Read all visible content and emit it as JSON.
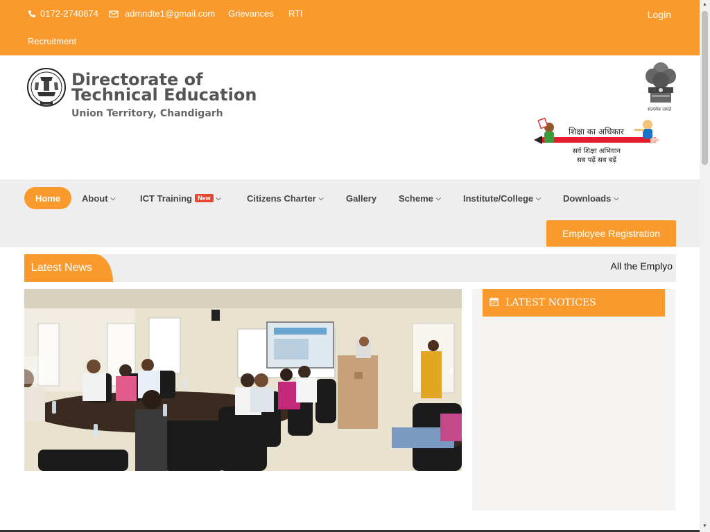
{
  "topbar": {
    "phone": "0172-2740674",
    "email": "admndte1@gmail.com",
    "grievances": "Grievances",
    "rti": "RTI",
    "recruitment": "Recruitment",
    "login": "Login",
    "phone_icon": "phone-icon",
    "email_icon": "envelope-icon"
  },
  "header": {
    "title": "Directorate of Technical Education",
    "subtitle": "Union Territory, Chandigarh",
    "emblem_caption": "सत्यमेव जयते",
    "ssa_title": "शिक्षा का अधिकार",
    "ssa_line1": "सर्व शिक्षा अभियान",
    "ssa_line2": "सब पढ़ें सब बढ़ें"
  },
  "nav": {
    "home": "Home",
    "about": "About",
    "ict": "ICT Training",
    "ict_badge": "New",
    "citizens": "Citizens Charter",
    "gallery": "Gallery",
    "scheme": "Scheme",
    "institute": "Institute/College",
    "downloads": "Downloads",
    "employee_registration": "Employee Registration"
  },
  "news": {
    "label": "Latest News",
    "ticker": "All the Emplyo"
  },
  "slider": {
    "prev": "‹",
    "next": "›"
  },
  "notices": {
    "title": "LATEST NOTICES",
    "icon": "calendar-icon"
  },
  "colors": {
    "accent": "#fb9a2c",
    "nav_bg": "#eeeeee",
    "badge": "#e8452c"
  }
}
